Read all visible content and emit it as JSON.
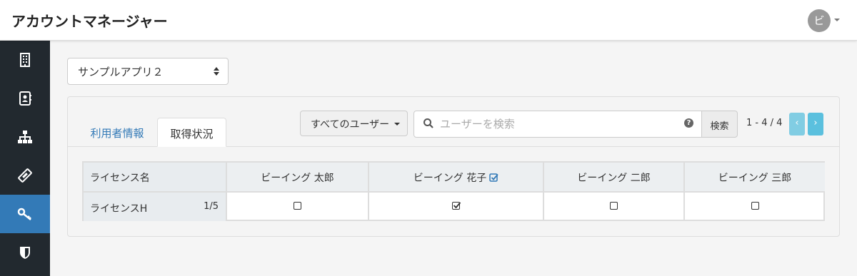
{
  "header": {
    "title": "アカウントマネージャー",
    "avatar_initial": "ビ"
  },
  "sidebar": {
    "items": [
      {
        "icon": "building-icon",
        "active": false
      },
      {
        "icon": "contact-book-icon",
        "active": false
      },
      {
        "icon": "org-chart-icon",
        "active": false
      },
      {
        "icon": "ticket-icon",
        "active": false
      },
      {
        "icon": "key-icon",
        "active": true
      },
      {
        "icon": "shield-icon",
        "active": false
      }
    ]
  },
  "app_select": {
    "value": "サンプルアプリ２"
  },
  "tabs": [
    {
      "label": "利用者情報",
      "active": false
    },
    {
      "label": "取得状況",
      "active": true
    }
  ],
  "toolbar": {
    "filter_label": "すべてのユーザー",
    "search_placeholder": "ユーザーを検索",
    "search_value": "",
    "search_button": "検索",
    "pagination": "1 - 4 / 4"
  },
  "license_table": {
    "label_header": "ライセンス名",
    "users": [
      {
        "name": "ビーイング 太郎",
        "verified": false
      },
      {
        "name": "ビーイング 花子",
        "verified": true
      },
      {
        "name": "ビーイング 二郎",
        "verified": false
      },
      {
        "name": "ビーイング 三郎",
        "verified": false
      }
    ],
    "rows": [
      {
        "name": "ライセンスH",
        "count": "1/5",
        "assigned": [
          false,
          true,
          false,
          false
        ]
      }
    ]
  },
  "colors": {
    "accent": "#337ab7",
    "sidebar_bg": "#22292f",
    "pager": "#5bc0de"
  }
}
